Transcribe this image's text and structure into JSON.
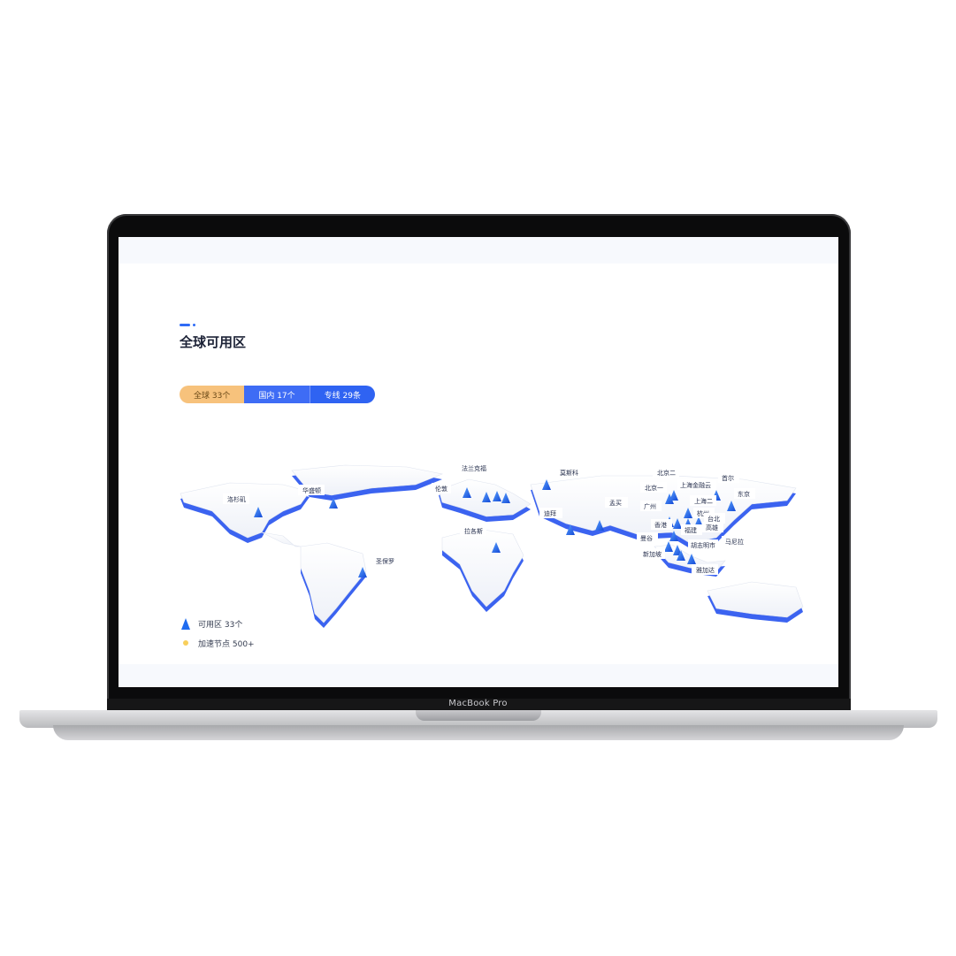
{
  "device": {
    "brand_label": "MacBook Pro"
  },
  "page": {
    "title": "全球可用区",
    "tabs": [
      {
        "label": "全球 33个",
        "active": true
      },
      {
        "label": "国内 17个",
        "active": false
      },
      {
        "label": "专线 29条",
        "active": false
      }
    ],
    "legend": [
      {
        "icon": "blue-pin-icon",
        "label": "可用区 33个"
      },
      {
        "icon": "yellow-dot-icon",
        "label": "加速节点 500+"
      }
    ],
    "map_labels": [
      "洛杉矶",
      "华盛顿",
      "圣保罗",
      "伦敦",
      "法兰克福",
      "莫斯科",
      "迪拜",
      "拉各斯",
      "孟买",
      "北京二",
      "北京一",
      "上海金融云",
      "首尔",
      "东京",
      "广州",
      "上海二",
      "杭州",
      "香港",
      "台北",
      "福建",
      "高雄",
      "曼谷",
      "胡志明市",
      "马尼拉",
      "新加坡",
      "雅加达"
    ],
    "colors": {
      "accent": "#2f6bf6",
      "active_tab": "#f7c27c",
      "map_pin": "#1f6cf0"
    }
  }
}
